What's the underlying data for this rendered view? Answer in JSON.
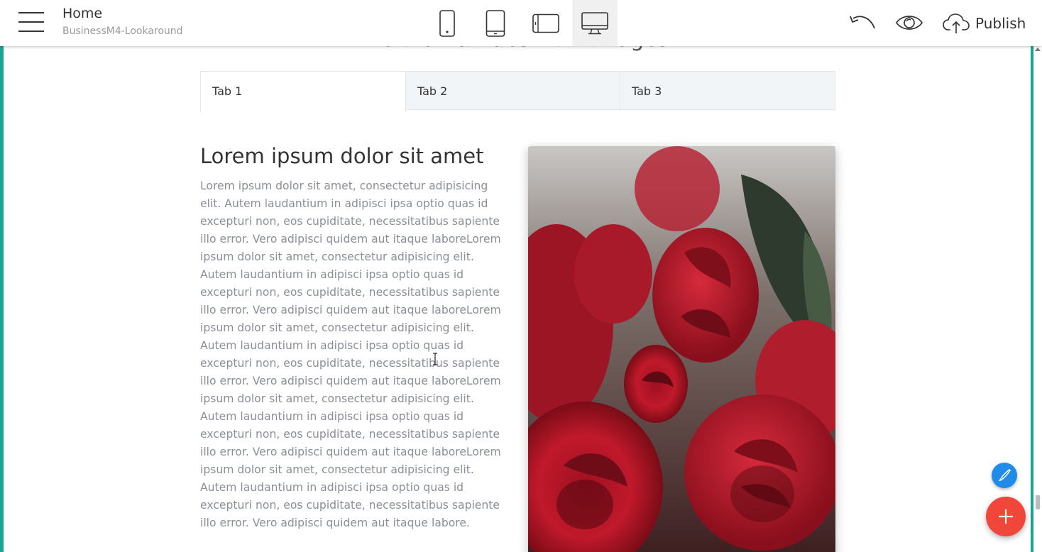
{
  "header": {
    "page_title": "Home",
    "project_name": "BusinessM4-Lookaround",
    "publish_label": "Publish",
    "active_device": "desktop"
  },
  "section": {
    "title": "Horizontal tabs with images",
    "tabs": [
      {
        "label": "Tab 1",
        "active": true
      },
      {
        "label": "Tab 2",
        "active": false
      },
      {
        "label": "Tab 3",
        "active": false
      }
    ],
    "heading": "Lorem ipsum dolor sit amet",
    "body": "Lorem ipsum dolor sit amet, consectetur adipisicing elit. Autem laudantium in adipisci ipsa optio quas id excepturi non, eos cupiditate, necessitatibus sapiente illo error. Vero adipisci quidem aut itaque laboreLorem ipsum dolor sit amet, consectetur adipisicing elit. Autem laudantium in adipisci ipsa optio quas id excepturi non, eos cupiditate, necessitatibus sapiente illo error. Vero adipisci quidem aut itaque laboreLorem ipsum dolor sit amet, consectetur adipisicing elit. Autem laudantium in adipisci ipsa optio quas id excepturi non, eos cupiditate, necessitatibus sapiente illo error. Vero adipisci quidem aut itaque laboreLorem ipsum dolor sit amet, consectetur adipisicing elit. Autem laudantium in adipisci ipsa optio quas id excepturi non, eos cupiditate, necessitatibus sapiente illo error. Vero adipisci quidem aut itaque laboreLorem ipsum dolor sit amet, consectetur adipisicing elit. Autem laudantium in adipisci ipsa optio quas id excepturi non, eos cupiditate, necessitatibus sapiente illo error. Vero adipisci quidem aut itaque labore.",
    "image_subject": "red roses"
  },
  "icons": {
    "menu": "hamburger-menu-icon",
    "devices": [
      "mobile-icon",
      "tablet-icon",
      "tablet-landscape-icon",
      "desktop-icon"
    ],
    "undo": "undo-icon",
    "preview": "eye-icon",
    "publish": "cloud-upload-icon",
    "brush": "brush-icon",
    "add": "plus-icon"
  },
  "colors": {
    "frame_accent": "#1aa391",
    "fab_add": "#f1473a",
    "fab_brush": "#1e8ce8"
  }
}
